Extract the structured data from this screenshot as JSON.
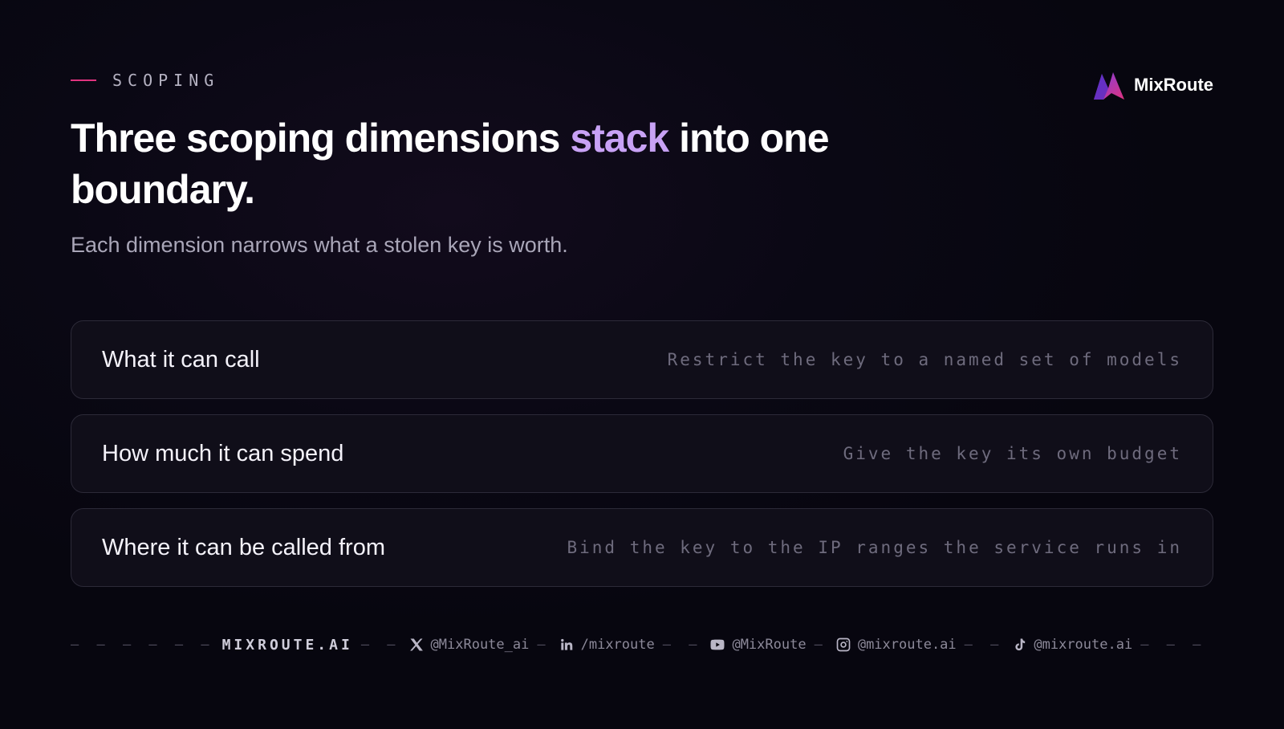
{
  "eyebrow": "SCOPING",
  "brand": {
    "name": "MixRoute"
  },
  "headline": {
    "before": "Three scoping dimensions ",
    "accent": "stack",
    "after": " into one boundary."
  },
  "subheadline": "Each dimension narrows what a stolen key is worth.",
  "rows": [
    {
      "title": "What it can call",
      "description": "Restrict the key to a named set of models"
    },
    {
      "title": "How much it can spend",
      "description": "Give the key its own budget"
    },
    {
      "title": "Where it can be called from",
      "description": "Bind the key to the IP ranges the service runs in"
    }
  ],
  "footer": {
    "site": "MIXROUTE.AI",
    "socials": [
      {
        "icon": "x-icon",
        "handle": "@MixRoute_ai"
      },
      {
        "icon": "linkedin-icon",
        "handle": "/mixroute"
      },
      {
        "icon": "youtube-icon",
        "handle": "@MixRoute"
      },
      {
        "icon": "instagram-icon",
        "handle": "@mixroute.ai"
      },
      {
        "icon": "tiktok-icon",
        "handle": "@mixroute.ai"
      }
    ]
  },
  "colors": {
    "accent": "#c8a2f5",
    "eyebrow_line": "#e0337f",
    "background": "#0a0814"
  }
}
